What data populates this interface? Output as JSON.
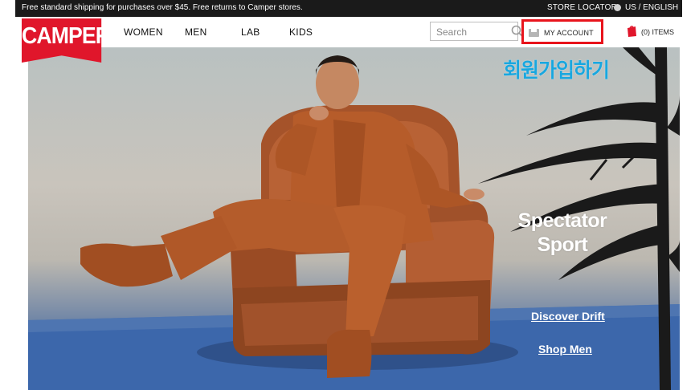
{
  "topbar": {
    "promo_text": "Free standard shipping for purchases over $45. Free returns to Camper stores.",
    "store_locator": "STORE LOCATOR",
    "locale": "US / ENGLISH"
  },
  "header": {
    "logo_text": "CAMPER",
    "nav": [
      "WOMEN",
      "MEN",
      "LAB",
      "KIDS"
    ],
    "search_placeholder": "Search",
    "account_label": "MY ACCOUNT",
    "cart_label": "(0) ITEMS"
  },
  "hero": {
    "title_line1": "Spectator",
    "title_line2": "Sport",
    "link_discover": "Discover Drift",
    "link_shop": "Shop Men"
  },
  "annotation": {
    "text": "회원가입하기",
    "color": "#19a7df",
    "highlight_color": "#e8141c"
  },
  "colors": {
    "brand_red": "#e0162b",
    "topbar_bg": "#1a1a1a"
  },
  "icons": [
    "search-icon",
    "globe-icon",
    "person-icon",
    "cart-icon"
  ]
}
